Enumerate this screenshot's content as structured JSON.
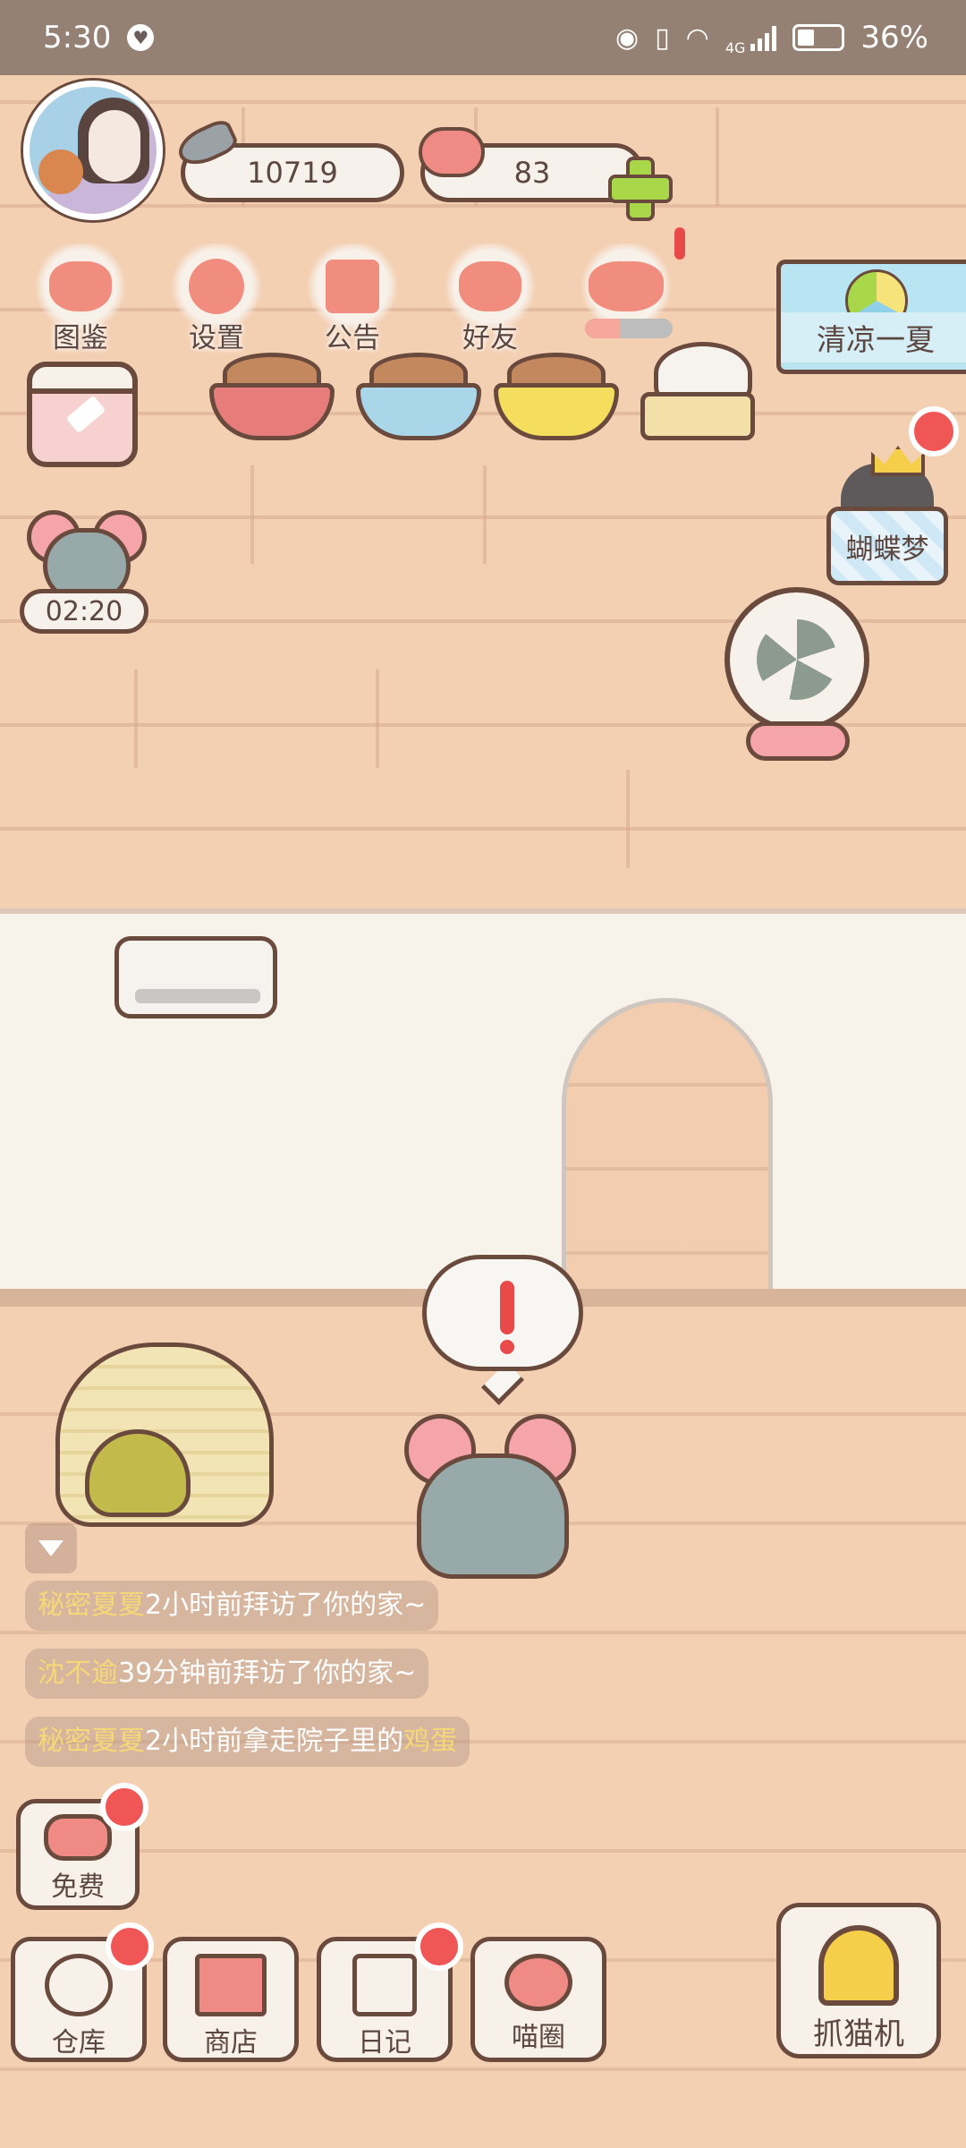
{
  "status_bar": {
    "time": "5:30",
    "network": "4G",
    "battery": "36%"
  },
  "currencies": {
    "fish": "10719",
    "hearts": "83"
  },
  "menu": [
    {
      "label": "图鉴",
      "icon": "cat-head-icon"
    },
    {
      "label": "设置",
      "icon": "gear-icon"
    },
    {
      "label": "公告",
      "icon": "gift-icon"
    },
    {
      "label": "好友",
      "icon": "friends-icon"
    },
    {
      "label": "",
      "icon": "heart-pair-icon"
    }
  ],
  "event_progress": 0.4,
  "summer_event": {
    "label": "清凉一夏"
  },
  "butterfly_dream": {
    "label": "蝴蝶梦"
  },
  "visitor_timer": "02:20",
  "visit_logs": [
    {
      "name": "秘密夏夏",
      "text": "2小时前拜访了你的家~",
      "item": ""
    },
    {
      "name": "沈不逾",
      "text": "39分钟前拜访了你的家~",
      "item": ""
    },
    {
      "name": "秘密夏夏",
      "text": "2小时前拿走院子里的",
      "item": "鸡蛋"
    }
  ],
  "bottom_buttons": {
    "free": "免费",
    "warehouse": "仓库",
    "shop": "商店",
    "diary": "日记",
    "meow_circle": "喵圈",
    "claw_machine": "抓猫机"
  },
  "colors": {
    "wall": "#f4d0b3",
    "outline": "#6b4a3e",
    "badge": "#f05656",
    "highlight_name": "#f6d878"
  }
}
